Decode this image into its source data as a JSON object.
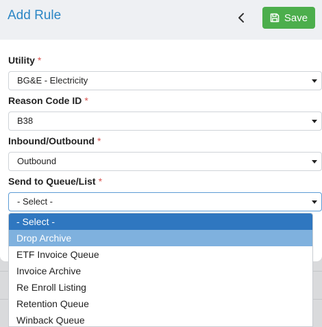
{
  "header": {
    "title": "Add Rule",
    "save_label": "Save"
  },
  "form": {
    "utility": {
      "label": "Utility",
      "required": "*",
      "value": "BG&E - Electricity"
    },
    "reason_code": {
      "label": "Reason Code ID",
      "required": "*",
      "value": "B38"
    },
    "direction": {
      "label": "Inbound/Outbound",
      "required": "*",
      "value": "Outbound"
    },
    "queue": {
      "label": "Send to Queue/List",
      "required": "*",
      "value": "- Select -"
    }
  },
  "dropdown": {
    "options": [
      {
        "label": "- Select -",
        "state": "selected"
      },
      {
        "label": "Drop Archive",
        "state": "hover"
      },
      {
        "label": "ETF Invoice Queue",
        "state": "normal"
      },
      {
        "label": "Invoice Archive",
        "state": "normal"
      },
      {
        "label": "Re Enroll Listing",
        "state": "normal"
      },
      {
        "label": "Retention Queue",
        "state": "normal"
      },
      {
        "label": "Winback Queue",
        "state": "normal"
      }
    ]
  },
  "colors": {
    "title": "#2b86c5",
    "save_button": "#4cae4c",
    "required": "#d9534f",
    "option_selected": "#2f77c0",
    "option_hover": "#7fb1de"
  },
  "icons": {
    "back": "chevron-left-icon",
    "save": "floppy-disk-icon",
    "dropdown": "caret-down-icon"
  }
}
